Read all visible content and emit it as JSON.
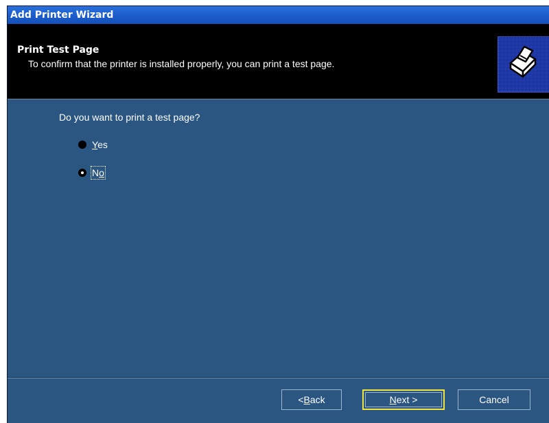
{
  "window": {
    "title": "Add Printer Wizard"
  },
  "header": {
    "title": "Print Test Page",
    "subtitle": "To confirm that the printer is installed properly, you can print a test page.",
    "icon": "printer-icon"
  },
  "question": "Do you want to print a test page?",
  "options": [
    {
      "label_prefix": "",
      "label_underline": "Y",
      "label_rest": "es",
      "selected": false
    },
    {
      "label_prefix": "N",
      "label_underline": "o",
      "label_rest": "",
      "selected": true
    }
  ],
  "buttons": {
    "back": {
      "prefix": "< ",
      "underline": "B",
      "rest": "ack"
    },
    "next": {
      "prefix": "",
      "underline": "N",
      "rest": "ext >"
    },
    "cancel": "Cancel"
  },
  "colors": {
    "background": "#2b5682",
    "header": "#000000",
    "titlebar": "#1c5ccb",
    "focus_highlight": "#f1e43a"
  }
}
